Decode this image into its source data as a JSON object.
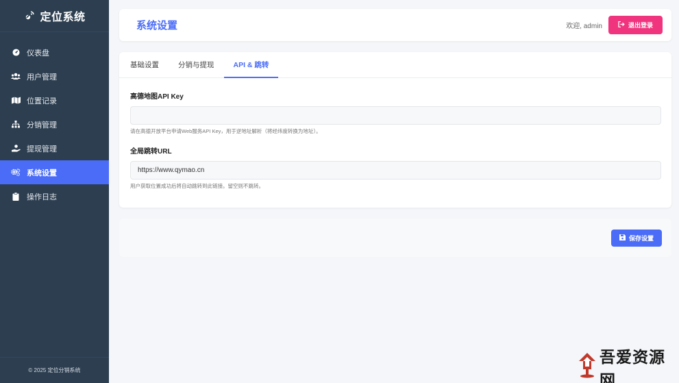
{
  "sidebar": {
    "brand": "定位系统",
    "items": [
      {
        "label": "仪表盘",
        "icon": "dashboard-icon",
        "active": false
      },
      {
        "label": "用户管理",
        "icon": "users-icon",
        "active": false
      },
      {
        "label": "位置记录",
        "icon": "map-icon",
        "active": false
      },
      {
        "label": "分销管理",
        "icon": "sitemap-icon",
        "active": false
      },
      {
        "label": "提现管理",
        "icon": "hand-money-icon",
        "active": false
      },
      {
        "label": "系统设置",
        "icon": "cogs-icon",
        "active": true
      },
      {
        "label": "操作日志",
        "icon": "clipboard-icon",
        "active": false
      }
    ],
    "footer": "© 2025 定位分销系统"
  },
  "header": {
    "title": "系统设置",
    "welcome": "欢迎, admin",
    "logout_label": "退出登录"
  },
  "tabs": [
    {
      "label": "基础设置",
      "active": false
    },
    {
      "label": "分销与提现",
      "active": false
    },
    {
      "label": "API & 跳转",
      "active": true
    }
  ],
  "form": {
    "amap_key": {
      "label": "高德地图API Key",
      "value": "",
      "help": "请在高德开放平台申请Web服务API Key，用于逆地址解析（将经纬度转换为地址）。"
    },
    "redirect_url": {
      "label": "全局跳转URL",
      "value": "https://www.qymao.cn",
      "help": "用户获取位置成功后将自动跳转到此链接。留空则不跳转。"
    }
  },
  "actions": {
    "save_label": "保存设置"
  },
  "watermark": {
    "text": "吾爱资源网"
  },
  "colors": {
    "sidebar_bg": "#2c3e50",
    "accent": "#4a6cf7",
    "logout": "#f0357e"
  }
}
